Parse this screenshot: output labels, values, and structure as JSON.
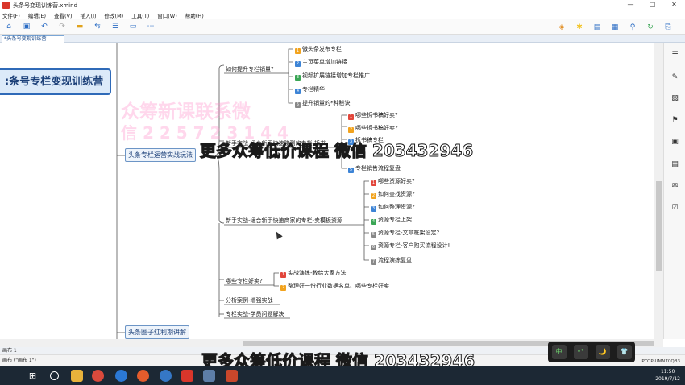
{
  "window": {
    "title": "头条号变现训练营.xmind",
    "controls": [
      "—",
      "□",
      "✕"
    ]
  },
  "menu": [
    "文件(F)",
    "编辑(E)",
    "查看(V)",
    "插入(I)",
    "修改(M)",
    "工具(T)",
    "窗口(W)",
    "帮助(H)"
  ],
  "tab": {
    "label": "*头条号变现训练营"
  },
  "root": {
    "label": ":条号专栏变现训练营"
  },
  "branches": [
    {
      "label": "头条专栏运营实战玩法"
    },
    {
      "label": "头条圈子红利期讲解"
    }
  ],
  "topics": {
    "t1": "如何提升专栏销量?",
    "t1_children": [
      "微头条发布专栏",
      "主页菜单增加链接",
      "视频扩展链接增加专栏推广",
      "专栏精华",
      "提升销量的*种秘诀"
    ],
    "t2": "新手实战-适合新手快速赚到的专栏-拆书",
    "t2_children": [
      "哪些拆书稿好卖?",
      "哪些拆书稿好卖?",
      "拆书稿专栏",
      "",
      "专栏销售流程复盘"
    ],
    "t3": "新手实战-适合新手快速商家的专栏-卖模板资源",
    "t3_children": [
      "哪些资源好卖?",
      "如何查找资源?",
      "如何整理资源?",
      "资源专栏上架",
      "资源专栏-文章框架设定?",
      "资源专栏-客户购买流程设计!",
      "流程演练复盘!"
    ],
    "t4": "哪些专栏好卖?",
    "t4_children": [
      "实战演练-教给大家方法",
      "整理好一份行业数据名单、哪些专栏好卖"
    ],
    "t5": "分析案例-增强实战",
    "t6": "专栏实战-学员问题解决"
  },
  "watermarks": {
    "pink": "众筹新课联系微",
    "pink2": "信 2 2 5 7 2 3 1 4 4",
    "big_top": "更多众筹低价课程  微信 203432946",
    "big_bottom": "更多众筹低价课程  微信 203432946"
  },
  "sheet": {
    "label": "画布 1"
  },
  "status": {
    "label": "画布 (\"画布 1\")"
  },
  "floatbar": [
    "中",
    "•°",
    "🌙",
    "👕"
  ],
  "clock": {
    "time": "11:50",
    "date": "2019/7/12",
    "machine": "PTOP-UMN70QB3"
  },
  "colors": {
    "accent": "#2f6ab8",
    "badge_red": "#e2463b",
    "badge_orange": "#f2a31e",
    "badge_blue": "#3d84d6",
    "badge_green": "#3aa655"
  }
}
